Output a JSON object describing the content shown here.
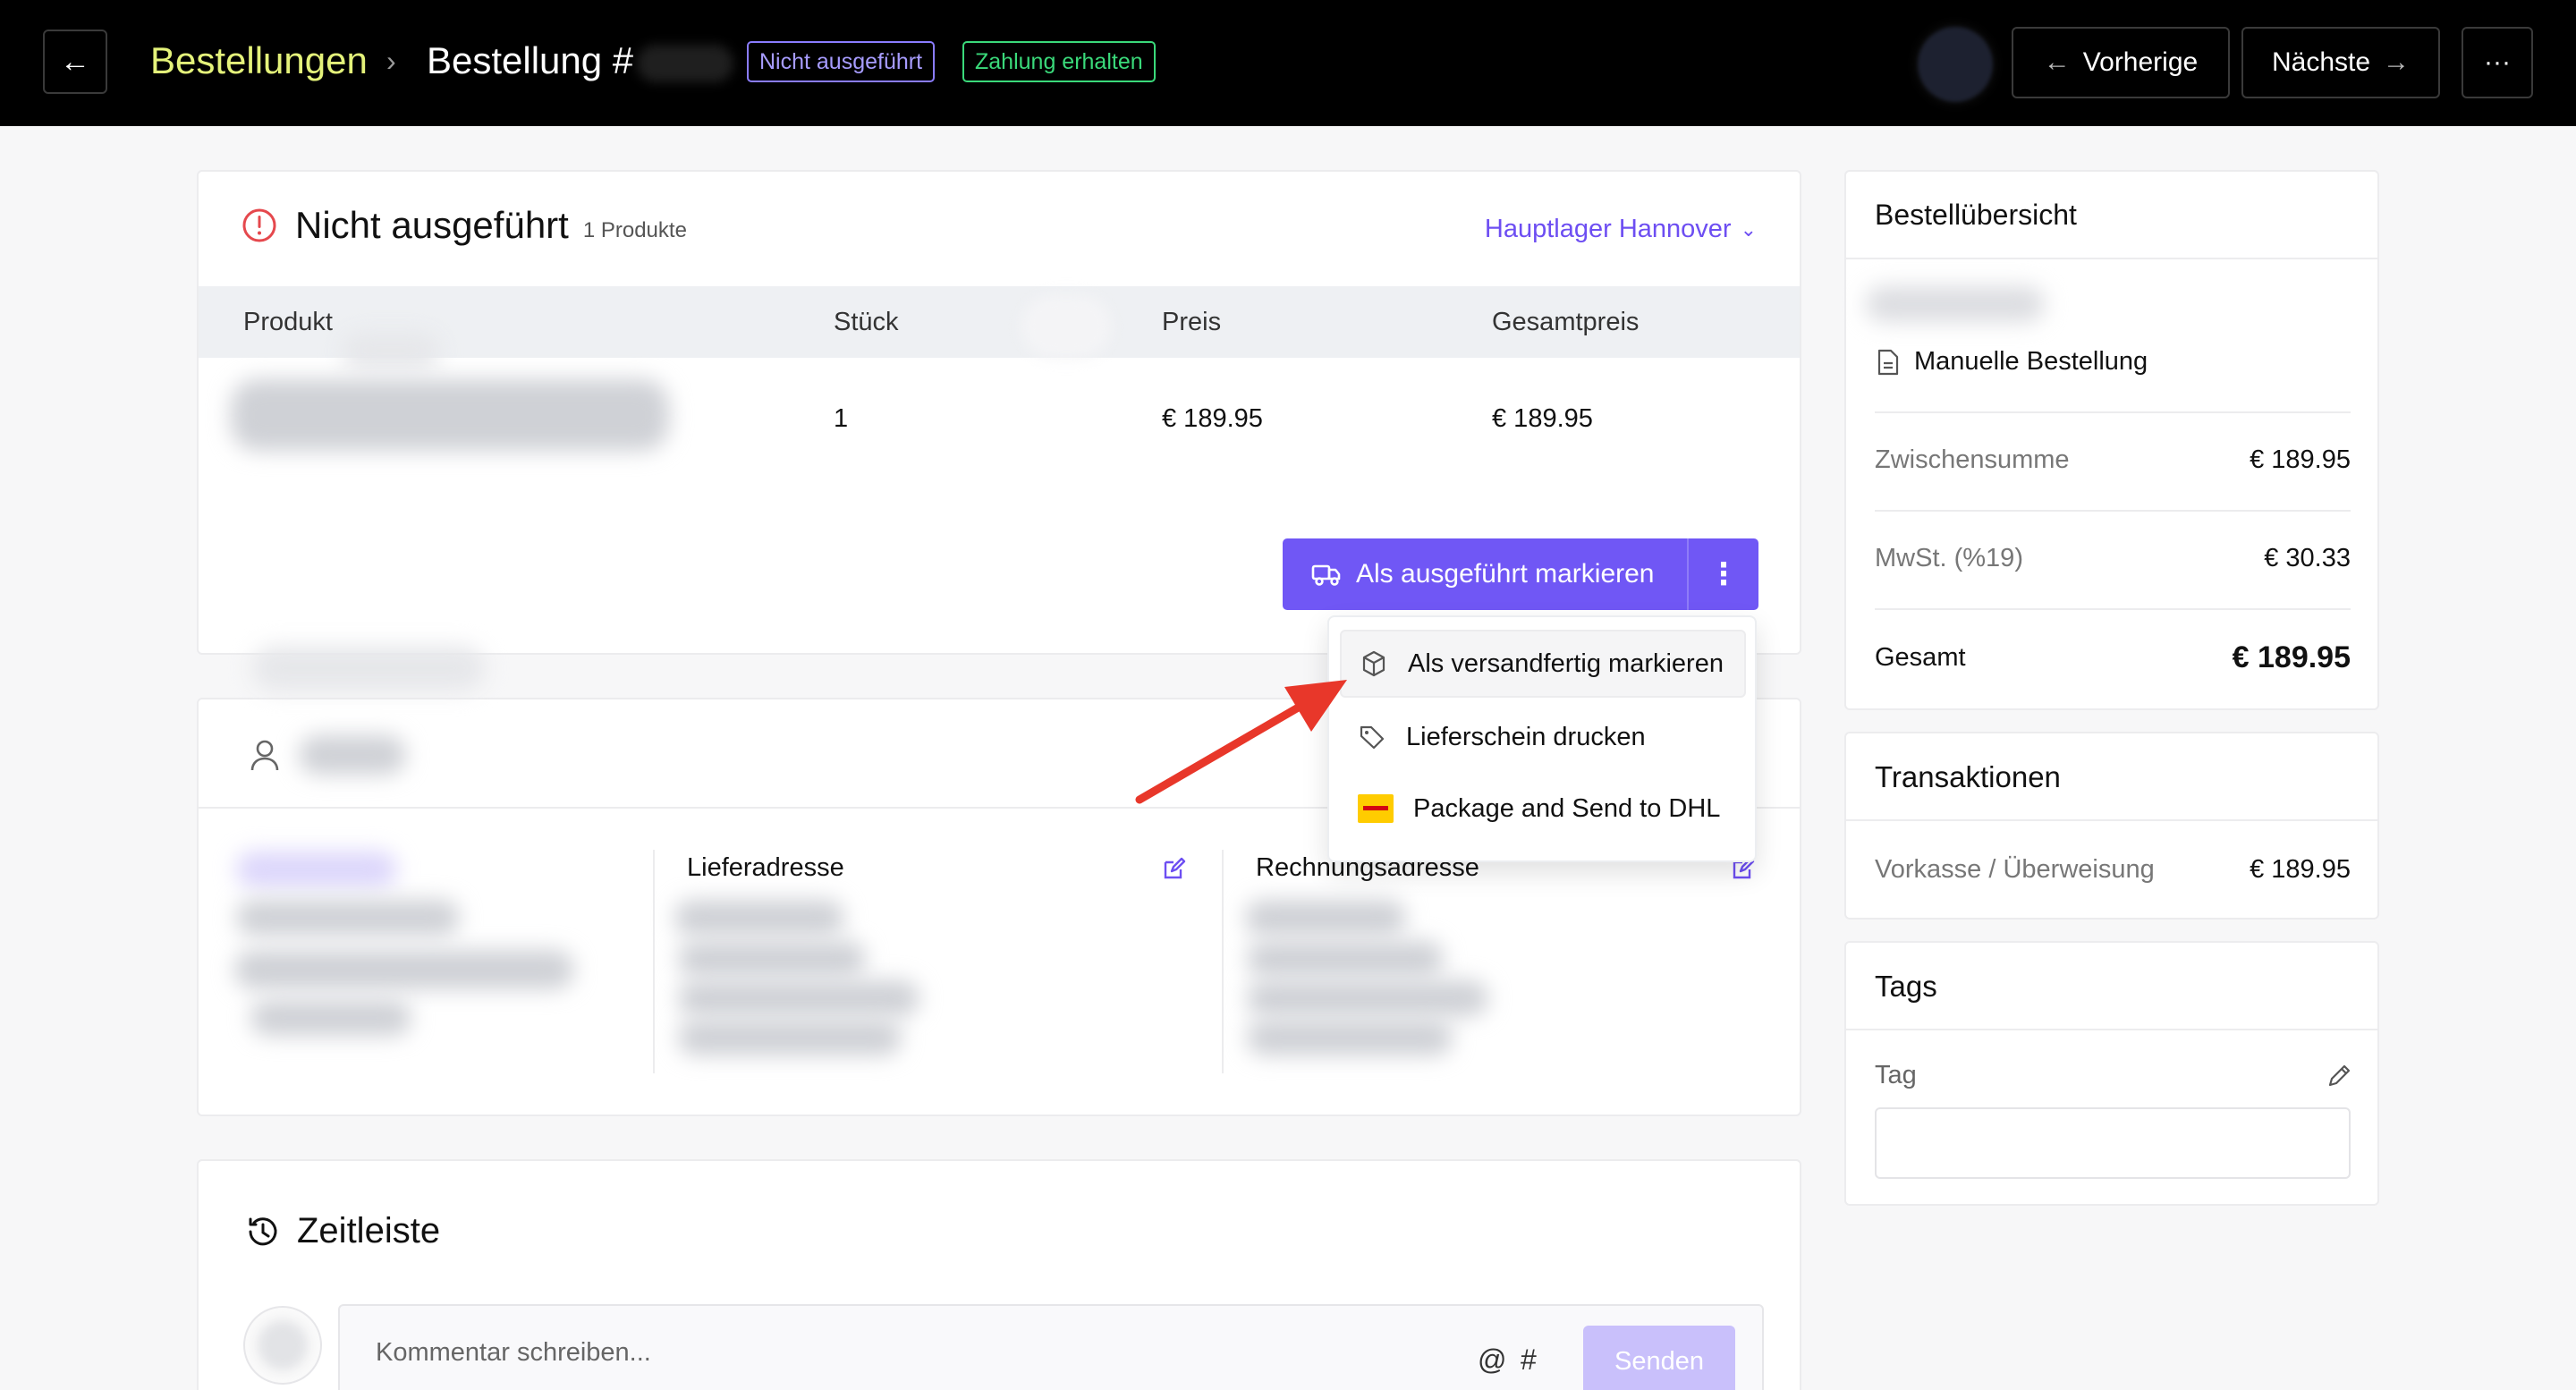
{
  "header": {
    "breadcrumb_root": "Bestellungen",
    "separator": "›",
    "order_label": "Bestellung #",
    "badge_status": "Nicht ausgeführt",
    "badge_payment": "Zahlung erhalten",
    "prev_label": "Vorherige",
    "next_label": "Nächste",
    "more_label": "···"
  },
  "products": {
    "title": "Nicht ausgeführt",
    "count": "1 Produkte",
    "warehouse": "Hauptlager Hannover",
    "columns": [
      "Produkt",
      "Stück",
      "Preis",
      "Gesamtpreis"
    ],
    "rows": [
      {
        "qty": "1",
        "price": "€ 189.95",
        "total": "€ 189.95"
      }
    ],
    "primary_action": "Als ausgeführt markieren"
  },
  "dropdown": {
    "items": [
      {
        "label": "Als versandfertig markieren",
        "icon": "box-icon"
      },
      {
        "label": "Lieferschein drucken",
        "icon": "tag-icon"
      },
      {
        "label": "Package and Send to DHL",
        "icon": "dhl-logo"
      }
    ]
  },
  "customer": {
    "shipping_title": "Lieferadresse",
    "billing_title": "Rechnungsadresse"
  },
  "timeline": {
    "title": "Zeitleiste",
    "comment_placeholder": "Kommentar schreiben...",
    "at_symbol": "@",
    "hash_symbol": "#",
    "send_label": "Senden"
  },
  "overview": {
    "title": "Bestellübersicht",
    "manual_order": "Manuelle Bestellung",
    "subtotal_label": "Zwischensumme",
    "subtotal_value": "€ 189.95",
    "tax_label": "MwSt. (%19)",
    "tax_value": "€ 30.33",
    "total_label": "Gesamt",
    "total_value": "€ 189.95"
  },
  "transactions": {
    "title": "Transaktionen",
    "method": "Vorkasse / Überweisung",
    "amount": "€ 189.95"
  },
  "tags": {
    "title": "Tags",
    "field_label": "Tag"
  },
  "colors": {
    "accent": "#7057f5",
    "breadcrumb": "#e4f27a",
    "status_unfulfilled": "#8a7cff",
    "status_paid": "#3ad97a",
    "alert": "#e5484d",
    "annotation_arrow": "#e8372a"
  }
}
